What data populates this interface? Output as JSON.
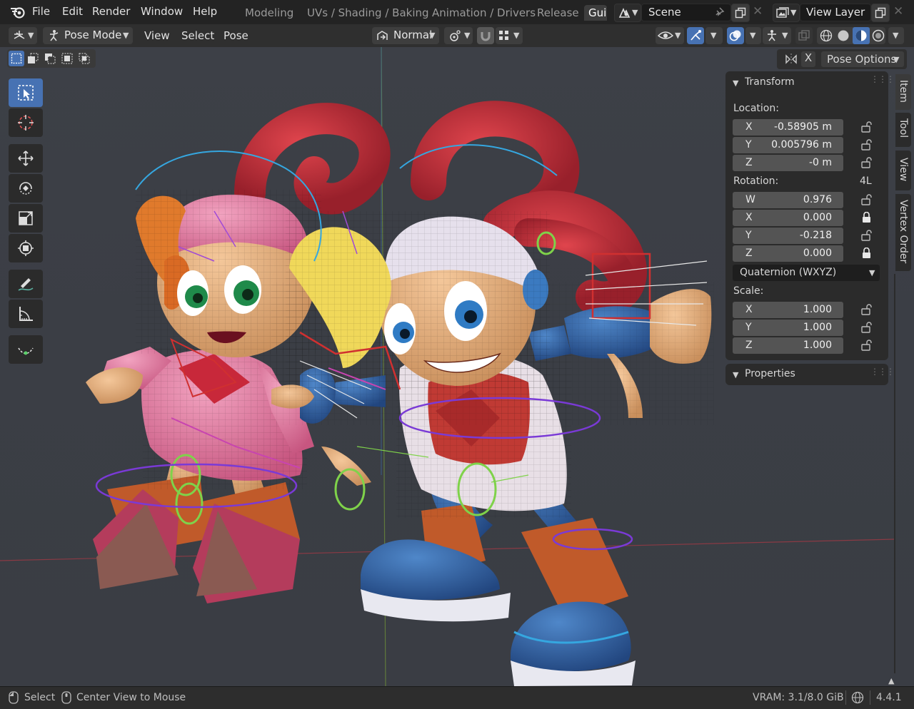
{
  "topbar": {
    "menus": [
      "File",
      "Edit",
      "Render",
      "Window",
      "Help"
    ],
    "workspace_tabs": [
      "Modeling",
      "UVs / Shading / Baking",
      "Animation / Drivers",
      "Release",
      "Gui"
    ],
    "active_tab": "Gui",
    "scene": "Scene",
    "view_layer": "View Layer"
  },
  "viewport_header": {
    "mode": "Pose Mode",
    "menus": [
      "View",
      "Select",
      "Pose"
    ],
    "orientation": "Normal",
    "pose_options": "Pose Options",
    "x_label": "X"
  },
  "toolbar": {
    "tools": [
      "select-box",
      "cursor",
      "move",
      "rotate",
      "scale",
      "transform",
      "annotate",
      "measure",
      "breakdowner"
    ],
    "active": "select-box"
  },
  "npanel": {
    "transform_title": "Transform",
    "location_label": "Location:",
    "location": [
      {
        "axis": "X",
        "value": "-0.58905 m"
      },
      {
        "axis": "Y",
        "value": "0.005796 m"
      },
      {
        "axis": "Z",
        "value": "-0 m"
      }
    ],
    "rotation_label": "Rotation:",
    "rotation_mode_tag": "4L",
    "rotation": [
      {
        "axis": "W",
        "value": "0.976",
        "locked": false
      },
      {
        "axis": "X",
        "value": "0.000",
        "locked": true
      },
      {
        "axis": "Y",
        "value": "-0.218",
        "locked": false
      },
      {
        "axis": "Z",
        "value": "0.000",
        "locked": true
      }
    ],
    "rotation_mode": "Quaternion (WXYZ)",
    "scale_label": "Scale:",
    "scale": [
      {
        "axis": "X",
        "value": "1.000"
      },
      {
        "axis": "Y",
        "value": "1.000"
      },
      {
        "axis": "Z",
        "value": "1.000"
      }
    ],
    "properties_title": "Properties"
  },
  "sidebar_tabs": [
    "Item",
    "Tool",
    "View",
    "Vertex Order"
  ],
  "statusbar": {
    "select": "Select",
    "center_view": "Center View to Mouse",
    "vram": "VRAM: 3.1/8.0 GiB",
    "version": "4.4.1"
  },
  "colors": {
    "accent": "#4772b3",
    "panel": "#2b2b2b",
    "field": "#545454",
    "viewport": "#3c3f46"
  }
}
